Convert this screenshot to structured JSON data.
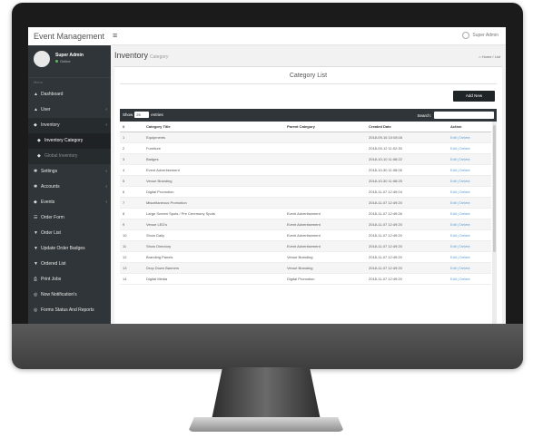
{
  "app": {
    "title": "Event Management",
    "menu_toggle": "≡"
  },
  "header": {
    "user_label": "Super Admin"
  },
  "sidebar": {
    "profile_name": "Super Admin",
    "profile_status": "Online",
    "menu_header": "Menu",
    "items": [
      {
        "label": "Dashboard",
        "icon": "dashboard-icon",
        "glyph": "▲"
      },
      {
        "label": "User",
        "icon": "user-icon",
        "glyph": "▲"
      },
      {
        "label": "Inventory",
        "icon": "inventory-icon",
        "glyph": "◆"
      },
      {
        "label": "Inventory Category",
        "icon": "category-icon",
        "glyph": "◆"
      },
      {
        "label": "Global Inventory",
        "icon": "globe-icon",
        "glyph": "◆"
      },
      {
        "label": "Settings",
        "icon": "gear-icon",
        "glyph": "✱"
      },
      {
        "label": "Accounts",
        "icon": "accounts-icon",
        "glyph": "✱"
      },
      {
        "label": "Events",
        "icon": "events-icon",
        "glyph": "◆"
      },
      {
        "label": "Order Form",
        "icon": "order-form-icon",
        "glyph": "☰"
      },
      {
        "label": "Order List",
        "icon": "order-list-icon",
        "glyph": "▼"
      },
      {
        "label": "Update Order Badges",
        "icon": "badge-icon",
        "glyph": "▼"
      },
      {
        "label": "Ordered List",
        "icon": "ordered-list-icon",
        "glyph": "▼"
      },
      {
        "label": "Print Jobs",
        "icon": "print-icon",
        "glyph": "⎙"
      },
      {
        "label": "Now Notification's",
        "icon": "notification-icon",
        "glyph": "◎"
      },
      {
        "label": "Forms Status And Reports",
        "icon": "reports-icon",
        "glyph": "◎"
      }
    ]
  },
  "page": {
    "title": "Inventory",
    "subtitle": "Category",
    "breadcrumb": "Home / List",
    "panel_title": "Category List",
    "add_button": "Add New"
  },
  "datatable": {
    "show_label": "Show",
    "page_size": "25",
    "entries_label": "entries",
    "search_label": "Search:",
    "columns": [
      "#",
      "Category Title",
      "Parent Category",
      "Created Date",
      "Action"
    ],
    "rows": [
      [
        "1",
        "Equipments",
        "",
        "2018-09-16 10:08:16",
        "Edit | Delete"
      ],
      [
        "2",
        "Furniture",
        "",
        "2018-09-12 11:02:30",
        "Edit | Delete"
      ],
      [
        "3",
        "Badges",
        "",
        "2018-10-10 11:08:22",
        "Edit | Delete"
      ],
      [
        "4",
        "Event Advertisement",
        "",
        "2018-10-30 11:08:05",
        "Edit | Delete"
      ],
      [
        "5",
        "Venue Branding",
        "",
        "2018-10-30 11:08:25",
        "Edit | Delete"
      ],
      [
        "6",
        "Digital Promotion",
        "",
        "2018-11-07 12:49:04",
        "Edit | Delete"
      ],
      [
        "7",
        "Miscellaneous Promotion",
        "",
        "2018-11-07 12:49:20",
        "Edit | Delete"
      ],
      [
        "8",
        "Large Screen Spots / Pre Ceremony Spots",
        "Event Advertisement",
        "2018-11-07 12:49:26",
        "Edit | Delete"
      ],
      [
        "9",
        "Venue LED's",
        "Event Advertisement",
        "2018-11-07 12:49:20",
        "Edit | Delete"
      ],
      [
        "10",
        "Show Daily",
        "Event Advertisement",
        "2018-11-07 12:49:20",
        "Edit | Delete"
      ],
      [
        "11",
        "Show Directory",
        "Event Advertisement",
        "2018-11-07 12:49:20",
        "Edit | Delete"
      ],
      [
        "12",
        "Branding Panels",
        "Venue Branding",
        "2018-11-07 12:49:20",
        "Edit | Delete"
      ],
      [
        "13",
        "Drop Down Banners",
        "Venue Branding",
        "2018-11-07 12:49:20",
        "Edit | Delete"
      ],
      [
        "14",
        "Digital Media",
        "Digital Promotion",
        "2018-11-07 12:49:20",
        "Edit | Delete"
      ]
    ]
  }
}
